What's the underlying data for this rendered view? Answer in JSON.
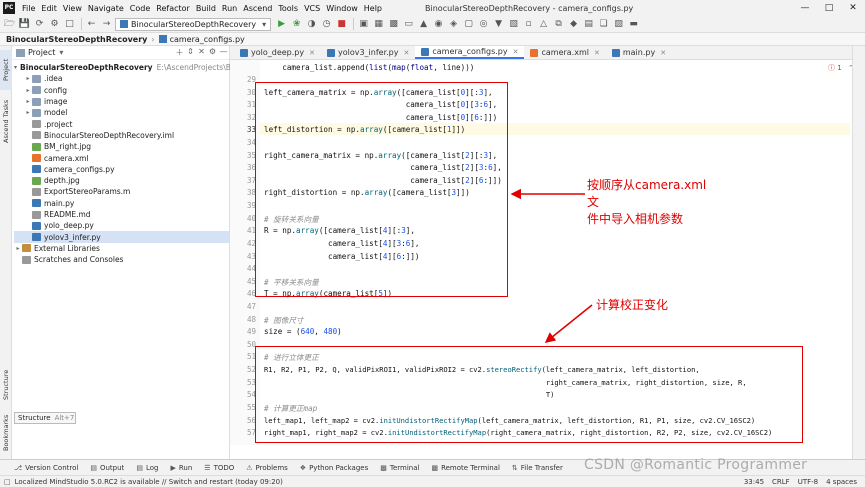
{
  "menu": {
    "logo": "PC",
    "items": [
      "File",
      "Edit",
      "View",
      "Navigate",
      "Code",
      "Refactor",
      "Build",
      "Run",
      "Ascend",
      "Tools",
      "VCS",
      "Window",
      "Help"
    ],
    "window_title": "BinocularStereoDepthRecovery - camera_configs.py"
  },
  "toolbar": {
    "run_config": "BinocularStereoDepthRecovery"
  },
  "nav": {
    "project": "BinocularStereoDepthRecovery",
    "file": "camera_configs.py"
  },
  "left_tabs": {
    "project": "Project",
    "ascend": "Ascend Tasks",
    "structure": "Structure",
    "bookmarks": "Bookmarks"
  },
  "project_panel": {
    "title": "Project",
    "root": "BinocularStereoDepthRecovery",
    "root_path": "E:\\AscendProjects\\Binoc",
    "items": [
      {
        "label": ".idea",
        "type": "folder"
      },
      {
        "label": "config",
        "type": "folder"
      },
      {
        "label": "image",
        "type": "folder"
      },
      {
        "label": "model",
        "type": "folder"
      },
      {
        "label": ".project",
        "type": "txt"
      },
      {
        "label": "BinocularStereoDepthRecovery.iml",
        "type": "txt"
      },
      {
        "label": "BM_right.jpg",
        "type": "img"
      },
      {
        "label": "camera.xml",
        "type": "xml"
      },
      {
        "label": "camera_configs.py",
        "type": "py"
      },
      {
        "label": "depth.jpg",
        "type": "img"
      },
      {
        "label": "ExportStereoParams.m",
        "type": "txt"
      },
      {
        "label": "main.py",
        "type": "py"
      },
      {
        "label": "README.md",
        "type": "txt"
      },
      {
        "label": "yolo_deep.py",
        "type": "py"
      },
      {
        "label": "yolov3_infer.py",
        "type": "py"
      }
    ],
    "external": "External Libraries",
    "scratches": "Scratches and Consoles"
  },
  "tooltip": {
    "label": "Structure",
    "shortcut": "Alt+7"
  },
  "tabs": [
    "yolo_deep.py",
    "yolov3_infer.py",
    "camera_configs.py",
    "camera.xml",
    "main.py"
  ],
  "error_count": "1",
  "code": {
    "l29": "    camera_list.append(list(map(float, line)))",
    "l30": "",
    "l31": "left_camera_matrix = np.array([camera_list[0][:3],",
    "l32": "                               camera_list[0][3:6],",
    "l33": "                               camera_list[0][6:]])",
    "l34": "left_distortion = np.array([camera_list[1]])",
    "l35": "",
    "l36": "right_camera_matrix = np.array([camera_list[2][:3],",
    "l37": "                                camera_list[2][3:6],",
    "l38": "                                camera_list[2][6:]])",
    "l39": "right_distortion = np.array([camera_list[3]])",
    "l40": "",
    "l41": "# 旋转关系向量",
    "l42": "R = np.array([camera_list[4][:3],",
    "l43": "              camera_list[4][3:6],",
    "l44": "              camera_list[4][6:]])",
    "l45": "",
    "l46": "# 平移关系向量",
    "l47": "T = np.array(camera_list[5])",
    "l48": "",
    "l49": "# 图像尺寸",
    "l50": "size = (640, 480)",
    "l51": "",
    "l52": "# 进行立体更正",
    "l53": "R1, R2, P1, P2, Q, validPixROI1, validPixROI2 = cv2.stereoRectify(left_camera_matrix, left_distortion,",
    "l54": "                                                                  right_camera_matrix, right_distortion, size, R,",
    "l55": "                                                                  T)",
    "l56": "# 计算更正map",
    "l57": "left_map1, left_map2 = cv2.initUndistortRectifyMap(left_camera_matrix, left_distortion, R1, P1, size, cv2.CV_16SC2)",
    "l58": "right_map1, right_map2 = cv2.initUndistortRectifyMap(right_camera_matrix, right_distortion, R2, P2, size, cv2.CV_16SC2)"
  },
  "annotations": {
    "a1_line1": "按顺序从camera.xml文",
    "a1_line2": "件中导入相机参数",
    "a2": "计算校正变化"
  },
  "tool_windows": [
    "Version Control",
    "Output",
    "Log",
    "Run",
    "TODO",
    "Problems",
    "Python Packages",
    "Terminal",
    "Remote Terminal",
    "File Transfer"
  ],
  "status": {
    "message": "Localized MindStudio 5.0.RC2 is available // Switch and restart (today 09:20)",
    "position": "33:45",
    "line_sep": "CRLF",
    "encoding": "UTF-8",
    "indent": "4 spaces"
  },
  "watermark": "CSDN @Romantic Programmer",
  "colors": {
    "accent": "#3574f0",
    "annotation": "#e00000"
  }
}
